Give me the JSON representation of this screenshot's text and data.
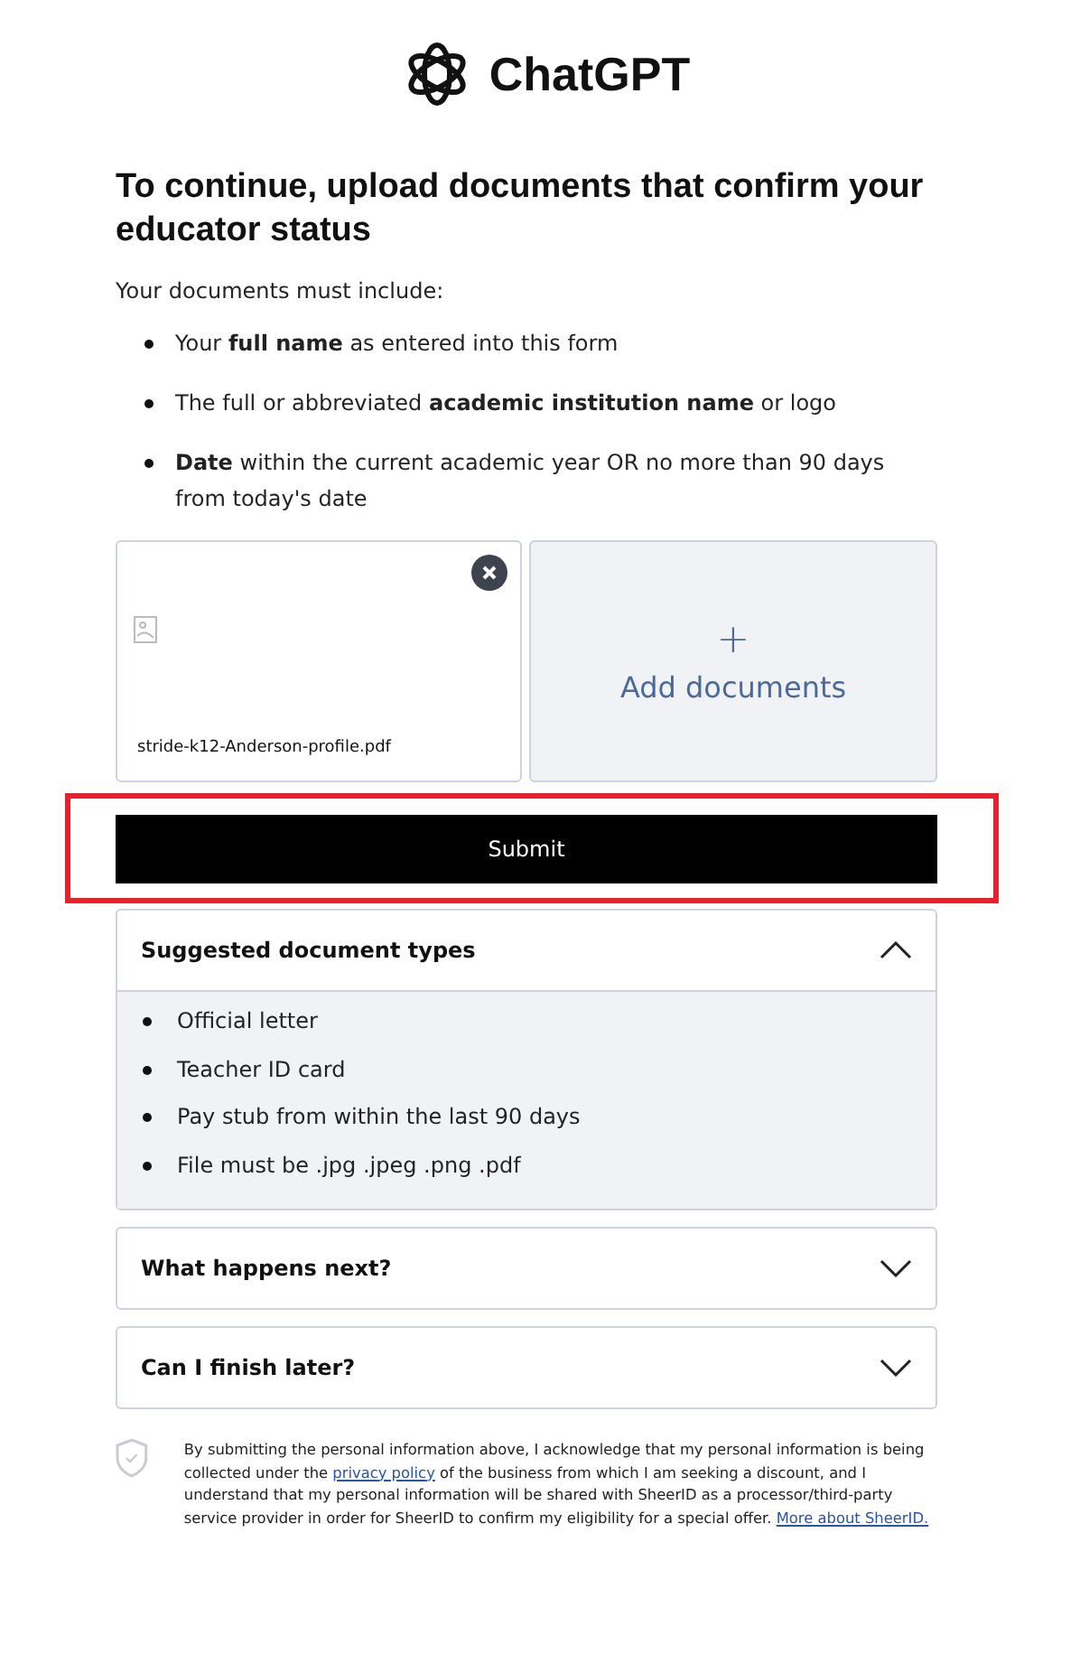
{
  "logo": {
    "text": "ChatGPT"
  },
  "heading": "To continue, upload documents that confirm your educator status",
  "intro": "Your documents must include:",
  "requirements": [
    "Your **full name** as entered into this form",
    "The full or abbreviated **academic institution name** or logo",
    "**Date** within the current academic year OR no more than 90 days from today's date"
  ],
  "uploads": [
    {
      "filename": "stride-k12-Anderson-profile.pdf"
    }
  ],
  "add_button": {
    "icon": "+",
    "label": "Add documents"
  },
  "submit": {
    "label": "Submit",
    "highlighted": true
  },
  "accordions": [
    {
      "title": "Suggested document types",
      "expanded": true,
      "items": [
        "Official letter",
        "Teacher ID card",
        "Pay stub from within the last 90 days",
        "File must be .jpg .jpeg .png .pdf"
      ]
    },
    {
      "title": "What happens next?",
      "expanded": false
    },
    {
      "title": "Can I finish later?",
      "expanded": false
    }
  ],
  "disclaimer": [
    {
      "kind": "text",
      "text": "By submitting the personal information above, I acknowledge that my personal information is being collected under the "
    },
    {
      "kind": "link",
      "text": "privacy policy"
    },
    {
      "kind": "text",
      "text": " of the business from which I am seeking a discount, and I understand that my personal information will be shared with SheerID as a processor/third-party service provider in order for SheerID to confirm my eligibility for a special offer. "
    },
    {
      "kind": "link",
      "text": "More about SheerID."
    }
  ]
}
